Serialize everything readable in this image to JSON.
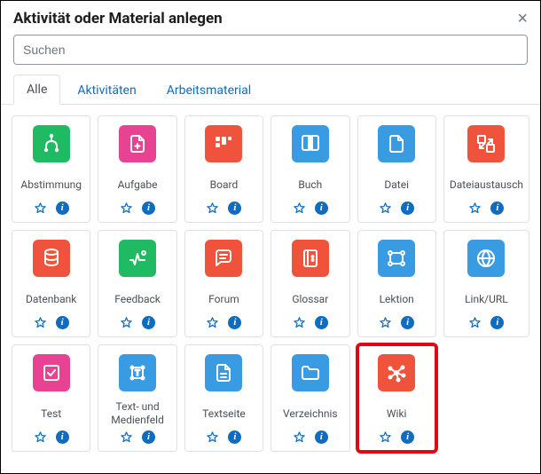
{
  "header": {
    "title": "Aktivität oder Material anlegen"
  },
  "search": {
    "placeholder": "Suchen"
  },
  "tabs": {
    "all": "Alle",
    "activities": "Aktivitäten",
    "resources": "Arbeitsmaterial"
  },
  "colors": {
    "green": "#20ba62",
    "pink": "#e84393",
    "coral": "#f0533c",
    "blue": "#399be2",
    "link": "#0f6cbf",
    "highlight": "#e30613"
  },
  "tiles": [
    {
      "id": "abstimmung",
      "label": "Abstimmung",
      "color": "green",
      "icon": "choice",
      "highlight": false
    },
    {
      "id": "aufgabe",
      "label": "Aufgabe",
      "color": "pink",
      "icon": "assign",
      "highlight": false
    },
    {
      "id": "board",
      "label": "Board",
      "color": "coral",
      "icon": "board",
      "highlight": false
    },
    {
      "id": "buch",
      "label": "Buch",
      "color": "blue",
      "icon": "book",
      "highlight": false
    },
    {
      "id": "datei",
      "label": "Datei",
      "color": "blue",
      "icon": "file",
      "highlight": false
    },
    {
      "id": "dateiaustausch",
      "label": "Dateiaustausch",
      "color": "coral",
      "icon": "exchange",
      "highlight": false
    },
    {
      "id": "datenbank",
      "label": "Datenbank",
      "color": "coral",
      "icon": "database",
      "highlight": false
    },
    {
      "id": "feedback",
      "label": "Feedback",
      "color": "green",
      "icon": "feedback",
      "highlight": false
    },
    {
      "id": "forum",
      "label": "Forum",
      "color": "coral",
      "icon": "forum",
      "highlight": false
    },
    {
      "id": "glossar",
      "label": "Glossar",
      "color": "coral",
      "icon": "glossar",
      "highlight": false
    },
    {
      "id": "lektion",
      "label": "Lektion",
      "color": "blue",
      "icon": "lesson",
      "highlight": false
    },
    {
      "id": "linkurl",
      "label": "Link/URL",
      "color": "blue",
      "icon": "url",
      "highlight": false
    },
    {
      "id": "test",
      "label": "Test",
      "color": "pink",
      "icon": "quiz",
      "highlight": false
    },
    {
      "id": "textmedien",
      "label": "Text- und Medienfeld",
      "color": "blue",
      "icon": "label",
      "highlight": false
    },
    {
      "id": "textseite",
      "label": "Textseite",
      "color": "blue",
      "icon": "page",
      "highlight": false
    },
    {
      "id": "verzeichnis",
      "label": "Verzeichnis",
      "color": "blue",
      "icon": "folder",
      "highlight": false
    },
    {
      "id": "wiki",
      "label": "Wiki",
      "color": "coral",
      "icon": "wiki",
      "highlight": true
    }
  ]
}
